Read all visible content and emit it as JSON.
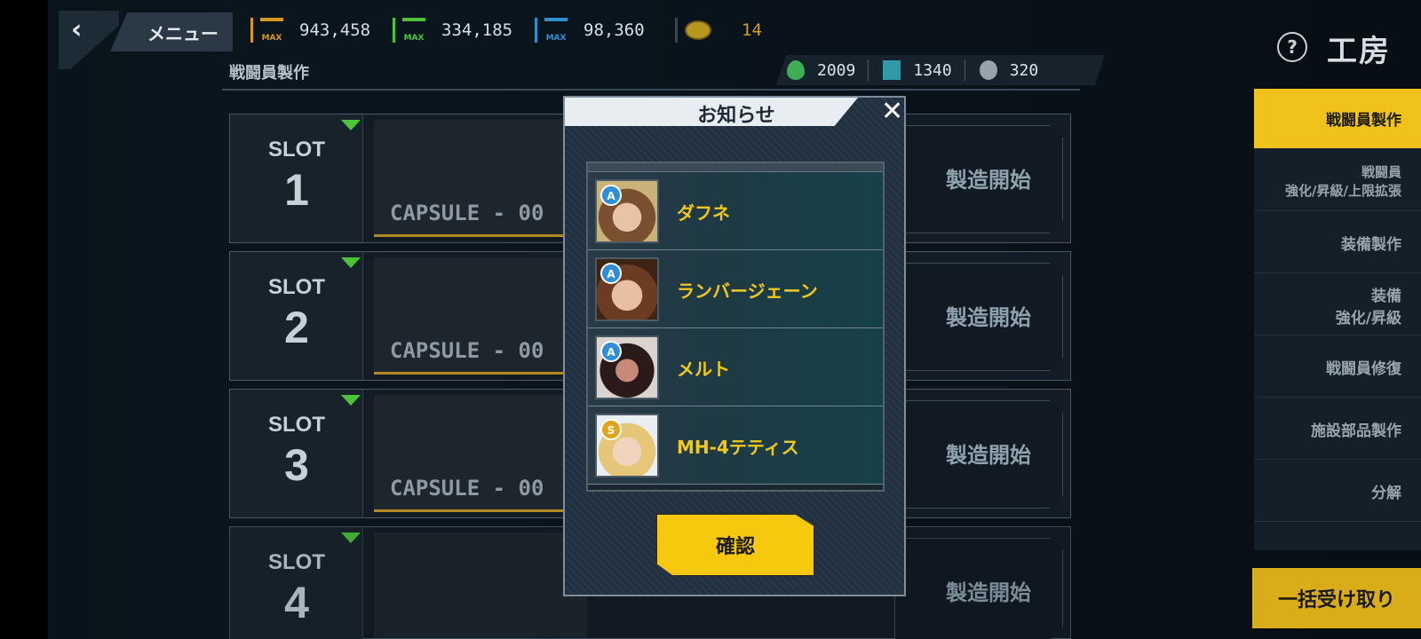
{
  "header": {
    "menu_label": "メニュー",
    "page_title": "工房",
    "resources": [
      {
        "name": "parts",
        "value": "943,458",
        "color": "#d49a1a",
        "badge": "MAX"
      },
      {
        "name": "nutrient",
        "value": "334,185",
        "color": "#4cc43a",
        "badge": "MAX"
      },
      {
        "name": "power",
        "value": "98,360",
        "color": "#2f8fd0",
        "badge": "MAX"
      },
      {
        "name": "token",
        "value": "14",
        "color": "#d2a020"
      }
    ]
  },
  "section": {
    "title": "戦闘員製作",
    "materials": [
      {
        "name": "green-material-icon",
        "value": "2009",
        "color": "#3fae55"
      },
      {
        "name": "chip-material-icon",
        "value": "1340",
        "color": "#2f9aa8"
      },
      {
        "name": "gear-material-icon",
        "value": "320",
        "color": "#9aa3ab"
      }
    ]
  },
  "slots": [
    {
      "label": "SLOT",
      "number": "1",
      "capsule": "CAPSULE - 00",
      "start": "製造開始"
    },
    {
      "label": "SLOT",
      "number": "2",
      "capsule": "CAPSULE - 00",
      "start": "製造開始"
    },
    {
      "label": "SLOT",
      "number": "3",
      "capsule": "CAPSULE - 00",
      "start": "製造開始"
    },
    {
      "label": "SLOT",
      "number": "4",
      "capsule": "",
      "start": "製造開始"
    }
  ],
  "sidebar": {
    "items": [
      {
        "line1": "戦闘員製作",
        "line2": ""
      },
      {
        "line1": "戦闘員",
        "line2": "強化/昇級/上限拡張"
      },
      {
        "line1": "装備製作",
        "line2": ""
      },
      {
        "line1": "装備",
        "line2": "強化/昇級"
      },
      {
        "line1": "戦闘員修復",
        "line2": ""
      },
      {
        "line1": "施設部品製作",
        "line2": ""
      },
      {
        "line1": "分解",
        "line2": ""
      }
    ],
    "bulk_label": "一括受け取り"
  },
  "modal": {
    "title": "お知らせ",
    "close": "✕",
    "confirm": "確認",
    "items": [
      {
        "name": "ダフネ",
        "rank": "A",
        "rank_color": "#2e8fd6"
      },
      {
        "name": "ランバージェーン",
        "rank": "A",
        "rank_color": "#2e8fd6"
      },
      {
        "name": "メルト",
        "rank": "A",
        "rank_color": "#2e8fd6"
      },
      {
        "name": "MH-4テティス",
        "rank": "S",
        "rank_color": "#e0a51a"
      }
    ]
  }
}
